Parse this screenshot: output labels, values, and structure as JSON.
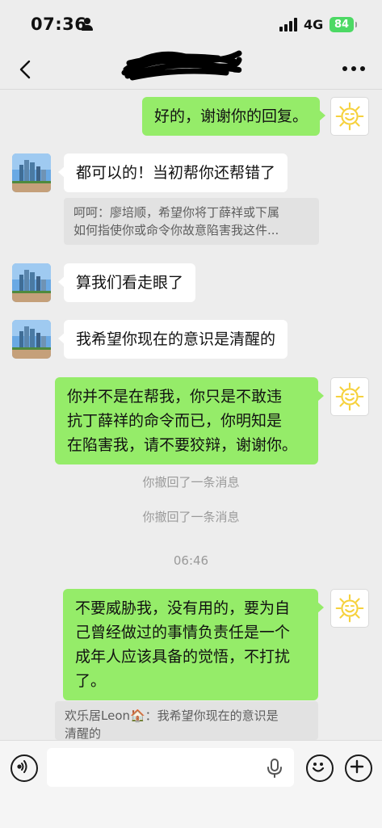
{
  "status_bar": {
    "time": "07:36",
    "network": "4G",
    "battery": "84"
  },
  "nav": {
    "title_redacted": true,
    "back_icon": "chevron-left-icon",
    "more_icon": "ellipsis-icon"
  },
  "messages": [
    {
      "id": "m1",
      "side": "right",
      "text": "好的，谢谢你的回复。"
    },
    {
      "id": "m2",
      "side": "left",
      "text": "都可以的！当初帮你还帮错了",
      "quote": {
        "line1": "呵呵：廖培顺，希望你将丁薛祥或下属",
        "line2": "如何指使你或命令你故意陷害我这件..."
      }
    },
    {
      "id": "m3",
      "side": "left",
      "text": "算我们看走眼了"
    },
    {
      "id": "m4",
      "side": "left",
      "text": "我希望你现在的意识是清醒的"
    },
    {
      "id": "m5",
      "side": "right",
      "lines": [
        "你并不是在帮我，你只是不敢违",
        "抗丁薛祥的命令而已，你明知是",
        "在陷害我，请不要狡辩，谢谢你。"
      ]
    },
    {
      "id": "s1",
      "type": "system",
      "text": "你撤回了一条消息"
    },
    {
      "id": "s2",
      "type": "system",
      "text": "你撤回了一条消息"
    },
    {
      "id": "t1",
      "type": "time",
      "text": "06:46"
    },
    {
      "id": "m6",
      "side": "right",
      "lines": [
        "不要威胁我，没有用的，要为自",
        "己曾经做过的事情负责任是一个",
        "成年人应该具备的觉悟，不打扰",
        "了。"
      ],
      "quote": {
        "line1": "欢乐居Leon🏠：我希望你现在的意识是",
        "line2": "清醒的"
      }
    }
  ],
  "input": {
    "placeholder": ""
  },
  "icons": {
    "voice": "voice-icon",
    "mic": "microphone-icon",
    "emoji": "emoji-icon",
    "plus": "plus-icon"
  },
  "colors": {
    "background": "#ededed",
    "sent_bubble": "#95ec69",
    "received_bubble": "#ffffff",
    "battery": "#4cd964"
  }
}
